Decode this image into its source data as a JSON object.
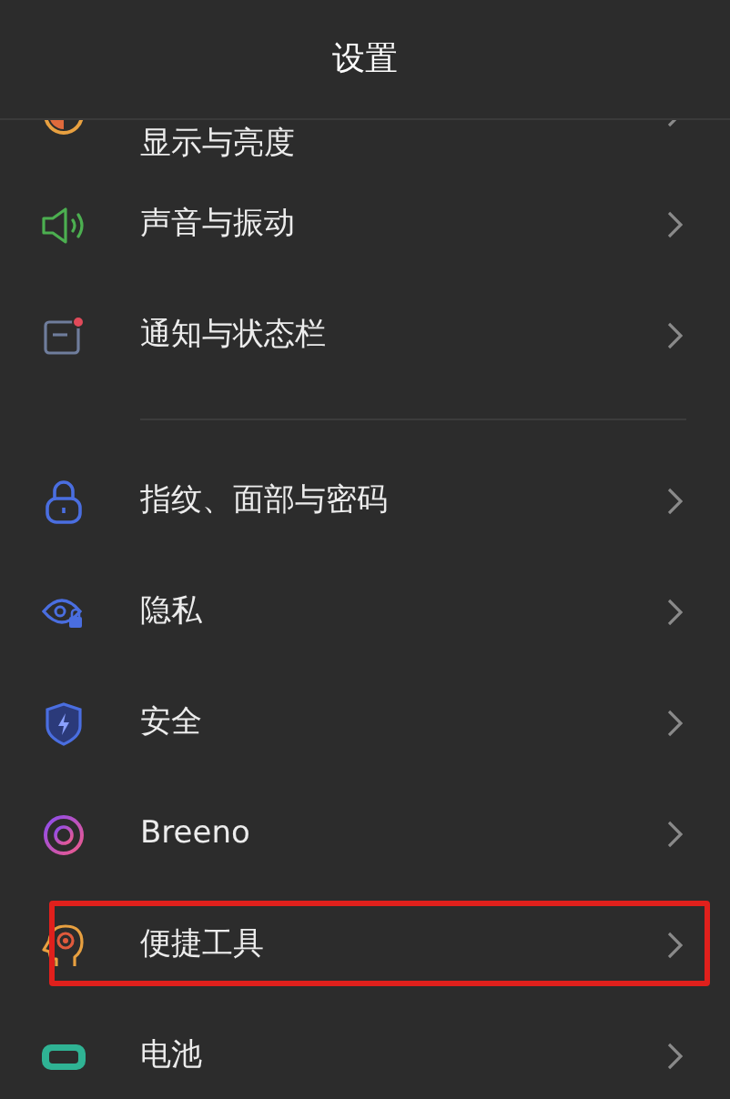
{
  "header": {
    "title": "设置"
  },
  "groups": [
    {
      "items": [
        {
          "kind": "display",
          "label": "显示与亮度",
          "highlighted": false
        },
        {
          "kind": "sound",
          "label": "声音与振动",
          "highlighted": false
        },
        {
          "kind": "notification",
          "label": "通知与状态栏",
          "highlighted": false
        }
      ]
    },
    {
      "items": [
        {
          "kind": "lock",
          "label": "指纹、面部与密码",
          "highlighted": false
        },
        {
          "kind": "privacy",
          "label": "隐私",
          "highlighted": false
        },
        {
          "kind": "security",
          "label": "安全",
          "highlighted": false
        },
        {
          "kind": "breeno",
          "label": "Breeno",
          "highlighted": false
        },
        {
          "kind": "tools",
          "label": "便捷工具",
          "highlighted": true
        },
        {
          "kind": "battery",
          "label": "电池",
          "highlighted": false
        }
      ]
    }
  ]
}
